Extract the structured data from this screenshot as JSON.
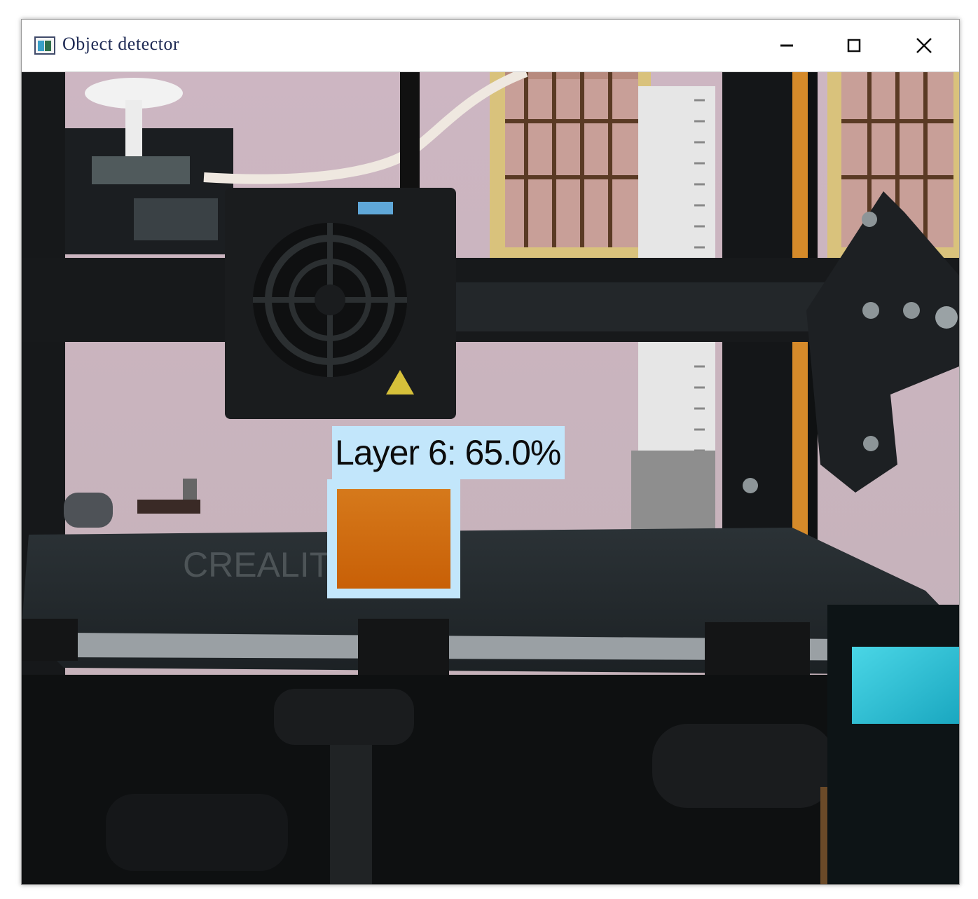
{
  "window": {
    "title": "Object detector",
    "icon": "app-window-icon",
    "controls": {
      "minimize": "minimize-icon",
      "maximize": "maximize-icon",
      "close": "close-icon"
    }
  },
  "detection": {
    "label": "Layer 6: 65.0%",
    "box_color": "#c2e6fb"
  },
  "colors": {
    "object": "#d06a10",
    "frame": "#17191b",
    "wall": "#c9b7bf",
    "window_frame": "#d8c07a"
  }
}
